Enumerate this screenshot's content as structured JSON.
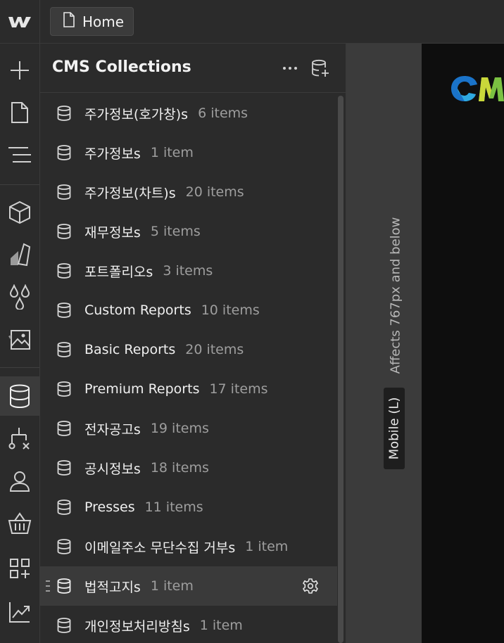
{
  "topbar": {
    "home_label": "Home"
  },
  "panel": {
    "title": "CMS Collections"
  },
  "collections": [
    {
      "name": "주가정보(호가창)s",
      "count": "6 items"
    },
    {
      "name": "주가정보s",
      "count": "1 item"
    },
    {
      "name": "주가정보(차트)s",
      "count": "20 items"
    },
    {
      "name": "재무정보s",
      "count": "5 items"
    },
    {
      "name": "포트폴리오s",
      "count": "3 items"
    },
    {
      "name": "Custom Reports",
      "count": "10 items"
    },
    {
      "name": "Basic Reports",
      "count": "20 items"
    },
    {
      "name": "Premium Reports",
      "count": "17 items"
    },
    {
      "name": "전자공고s",
      "count": "19 items"
    },
    {
      "name": "공시정보s",
      "count": "18 items"
    },
    {
      "name": "Presses",
      "count": "11 items"
    },
    {
      "name": "이메일주소 무단수집 거부s",
      "count": "1 item"
    },
    {
      "name": "법적고지s",
      "count": "1 item"
    },
    {
      "name": "개인정보처리방침s",
      "count": "1 item"
    }
  ],
  "canvas": {
    "affects_text": "Affects 767px and below",
    "breakpoint_label": "Mobile (L)"
  },
  "colors": {
    "panel_bg": "#2b2b2b",
    "hover_bg": "#3a3a3a",
    "preview_bg": "#0e0e0e"
  }
}
